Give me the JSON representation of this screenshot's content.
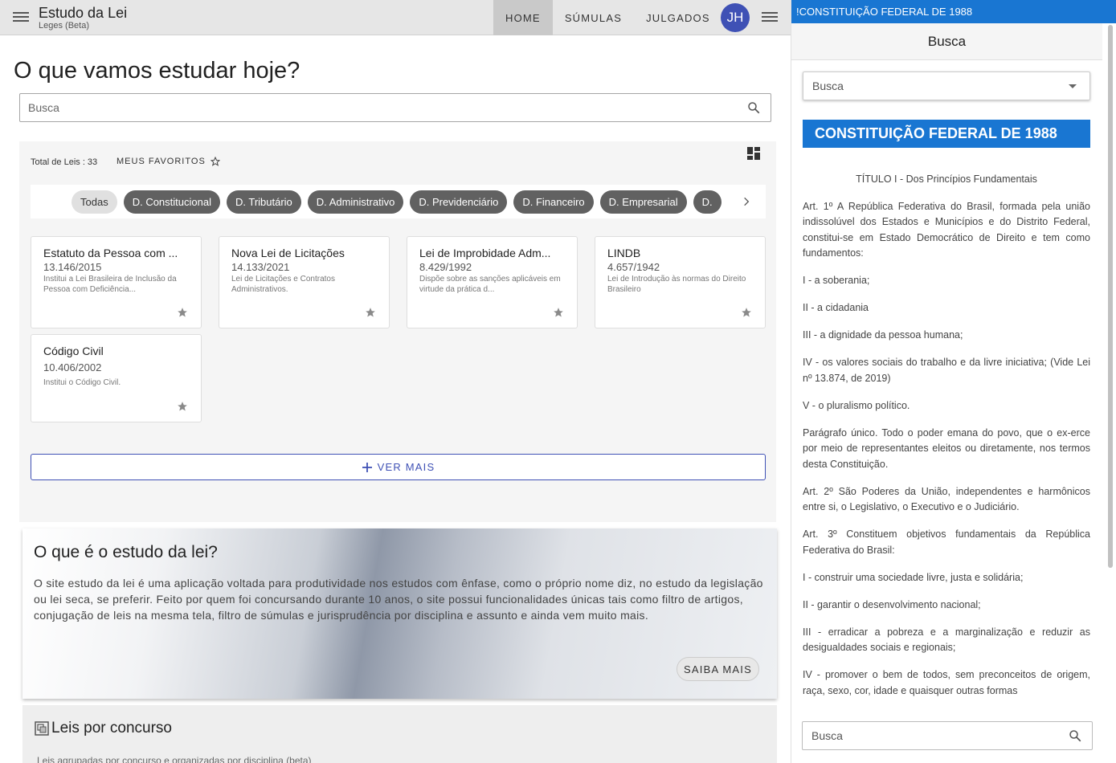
{
  "appbar": {
    "title": "Estudo da Lei",
    "subtitle": "Leges (Beta)",
    "nav": [
      "HOME",
      "SÚMULAS",
      "JULGADOS"
    ],
    "avatar": "JH"
  },
  "main": {
    "heading": "O que vamos estudar hoje?",
    "search_placeholder": "Busca",
    "total_leis": "Total de Leis : 33",
    "favoritos": "MEUS FAVORITOS",
    "chips": [
      "Todas",
      "D. Constitucional",
      "D. Tributário",
      "D. Administrativo",
      "D. Previdenciário",
      "D. Financeiro",
      "D. Empresarial",
      "D."
    ],
    "cards": [
      {
        "title": "Estatuto da Pessoa com ...",
        "number": "13.146/2015",
        "desc": "Institui a Lei Brasileira de Inclusão da Pessoa com Deficiência..."
      },
      {
        "title": "Nova Lei de Licitações",
        "number": "14.133/2021",
        "desc": "Lei de Licitações e Contratos Administrativos."
      },
      {
        "title": "Lei de Improbidade Adm...",
        "number": "8.429/1992",
        "desc": "Dispõe sobre as sanções aplicáveis em virtude da prática d..."
      },
      {
        "title": "LINDB",
        "number": "4.657/1942",
        "desc": "Lei de Introdução às normas do Direito Brasileiro"
      },
      {
        "title": "Código Civil",
        "number": "10.406/2002",
        "desc": "Institui o Código Civil."
      }
    ],
    "ver_mais": "VER MAIS"
  },
  "estudo": {
    "title": "O que é o estudo da lei?",
    "text": "O site estudo da lei é uma aplicação voltada para produtividade nos estudos com ênfase, como o próprio nome diz, no estudo da legislação ou lei seca, se preferir. Feito por quem foi concursando durante 10 anos, o site possui funcionalidades únicas tais como filtro de artigos, conjugação de leis na mesma tela, filtro de súmulas e jurisprudência por disciplina e assunto e ainda vem muito mais.",
    "button": "SAIBA MAIS"
  },
  "concurso": {
    "title": "Leis por concurso",
    "subtitle": "Leis agrupadas por concurso e organizadas por disciplina (beta)"
  },
  "right": {
    "top_title": "!CONSTITUIÇÃO FEDERAL DE 1988",
    "head": "Busca",
    "select_value": "Busca",
    "banner": "CONSTITUIÇÃO FEDERAL DE 1988",
    "titulo": "TÍTULO I - Dos Princípios Fundamentais",
    "paragraphs": [
      "Art. 1º A República Federativa do Brasil, formada pela união indissolúvel dos Estados e Municípios e do Distrito Federal, constitui-se em Estado Democrático de Direito e tem como fundamentos:",
      "I - a soberania;",
      "II - a cidadania",
      "III - a dignidade da pessoa humana;",
      "IV - os valores sociais do trabalho e da livre iniciativa; (Vide Lei nº 13.874, de 2019)",
      "V - o pluralismo político.",
      "Parágrafo único. Todo o poder emana do povo, que o ex-erce por meio de representantes eleitos ou diretamente, nos termos desta Constituição.",
      "Art. 2º São Poderes da União, independentes e harmônicos entre si, o Legislativo, o Executivo e o Judiciário.",
      "Art. 3º Constituem objetivos fundamentais da República Federativa do Brasil:",
      "I - construir uma sociedade livre, justa e solidária;",
      "II - garantir o desenvolvimento nacional;",
      "III - erradicar a pobreza e a marginalização e reduzir as desigualdades sociais e regionais;",
      "IV - promover o bem de todos, sem preconceitos de origem, raça, sexo, cor, idade e quaisquer outras formas"
    ],
    "search_placeholder": "Busca"
  }
}
